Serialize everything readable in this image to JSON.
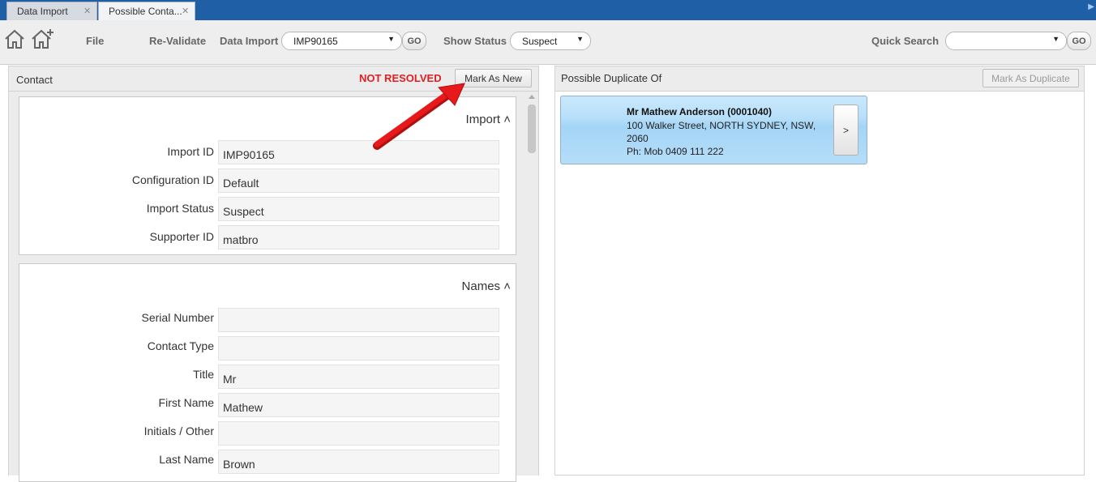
{
  "tabs": [
    {
      "label": "Data Import",
      "active": false
    },
    {
      "label": "Possible Conta...",
      "active": true
    }
  ],
  "toolbar": {
    "file_label": "File",
    "revalidate_label": "Re-Validate",
    "data_import_label": "Data Import",
    "data_import_value": "IMP90165",
    "go_label": "GO",
    "show_status_label": "Show Status",
    "show_status_value": "Suspect",
    "quick_search_label": "Quick Search",
    "quick_search_value": "",
    "quick_go_label": "GO",
    "icons": [
      "home-icon",
      "home-add-icon"
    ]
  },
  "contact_panel": {
    "title": "Contact",
    "status_text": "NOT RESOLVED",
    "status_color": "#e02020",
    "mark_new_label": "Mark As New",
    "import_section": {
      "title": "Import",
      "fields": [
        {
          "label": "Import ID",
          "value": "IMP90165"
        },
        {
          "label": "Configuration ID",
          "value": "Default"
        },
        {
          "label": "Import Status",
          "value": "Suspect"
        },
        {
          "label": "Supporter ID",
          "value": "matbro"
        }
      ]
    },
    "names_section": {
      "title": "Names",
      "fields": [
        {
          "label": "Serial Number",
          "value": ""
        },
        {
          "label": "Contact Type",
          "value": ""
        },
        {
          "label": "Title",
          "value": "Mr"
        },
        {
          "label": "First Name",
          "value": "Mathew"
        },
        {
          "label": "Initials / Other",
          "value": ""
        },
        {
          "label": "Last Name",
          "value": "Brown"
        }
      ]
    }
  },
  "duplicate_panel": {
    "title": "Possible Duplicate Of",
    "mark_dup_label": "Mark As Duplicate",
    "card": {
      "name": "Mr Mathew Anderson  (0001040)",
      "address_line1": "100 Walker Street, NORTH SYDNEY, NSW,",
      "address_line2": "2060",
      "phone": "Ph: Mob 0409 111 222",
      "go_label": ">"
    }
  },
  "colors": {
    "tabbar": "#1f5fa6",
    "annotation_arrow": "#e8191b",
    "card_blue": "#b9e0fa"
  }
}
